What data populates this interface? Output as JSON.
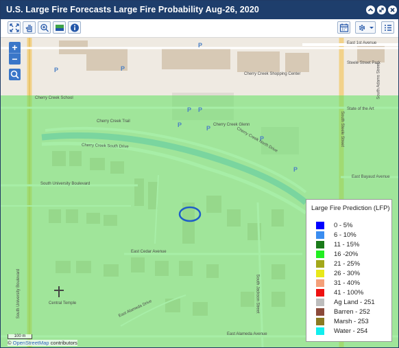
{
  "window": {
    "title": "U.S. Large Fire Forecasts Large Fire Probability Aug-26, 2020",
    "controls": [
      "collapse",
      "maximize",
      "close"
    ]
  },
  "toolbar": {
    "left_tools": [
      "full-extent-icon",
      "pan-hand-icon",
      "zoom-in-box-icon",
      "layers-icon",
      "info-icon"
    ],
    "right_tools": [
      "calendar-icon",
      "gear-icon",
      "list-icon"
    ]
  },
  "map": {
    "zoom_in_label": "+",
    "zoom_out_label": "−",
    "labels": {
      "cherry_creek_trail": "Cherry Creek Trail",
      "cherry_creek_south_drive": "Cherry Creek South Drive",
      "cherry_creek_north_drive": "Cherry Creek North Drive",
      "south_university_boulevard": "South University Boulevard",
      "south_university_vertical": "South University Boulevard",
      "south_steele_street": "South Steele Street",
      "south_adams_street": "South Adams Street",
      "east_bayaud_avenue": "East Bayaud Avenue",
      "east_cedar_avenue": "East Cedar Avenue",
      "east_alameda_drive": "East Alameda Drive",
      "east_alameda_avenue": "East Alameda Avenue",
      "south_jackson_street": "South Jackson Street",
      "cherry_creek_shopping_center": "Cherry Creek Shopping Center",
      "cherry_creek_glenn": "Cherry Creek Glenn",
      "steele_street_park": "Steele Street Park",
      "state_of_the_art": "State of the Art",
      "cherry_creek_school": "Cherry Creek School",
      "central_staircase": "Central Temple",
      "east_1st_avenue": "East 1st Avenue"
    },
    "scale_label": "100 m",
    "attribution_prefix": "©",
    "attribution_link": "OpenStreetMap",
    "attribution_suffix": "contributors"
  },
  "legend": {
    "title": "Large Fire Prediction (LFP)",
    "items": [
      {
        "label": "0 - 5%",
        "color": "#0000ff"
      },
      {
        "label": "6 - 10%",
        "color": "#3a8df0"
      },
      {
        "label": "11 - 15%",
        "color": "#1a7a1a"
      },
      {
        "label": "16 -20%",
        "color": "#22ee22"
      },
      {
        "label": "21 - 25%",
        "color": "#a3a81a"
      },
      {
        "label": "26 - 30%",
        "color": "#e8e81a"
      },
      {
        "label": "31 - 40%",
        "color": "#f4a07a"
      },
      {
        "label": "41 - 100%",
        "color": "#ee1111"
      },
      {
        "label": "Ag Land - 251",
        "color": "#bdbdbd"
      },
      {
        "label": "Barren - 252",
        "color": "#8b4a3a"
      },
      {
        "label": "Marsh - 253",
        "color": "#8b7a22"
      },
      {
        "label": "Water - 254",
        "color": "#11eeee"
      }
    ]
  },
  "colors": {
    "title_bar": "#1e3e6c",
    "overlay_green": "#5ee05e",
    "control_blue": "#3a76c8",
    "circle_mark": "#1e5ec8"
  }
}
